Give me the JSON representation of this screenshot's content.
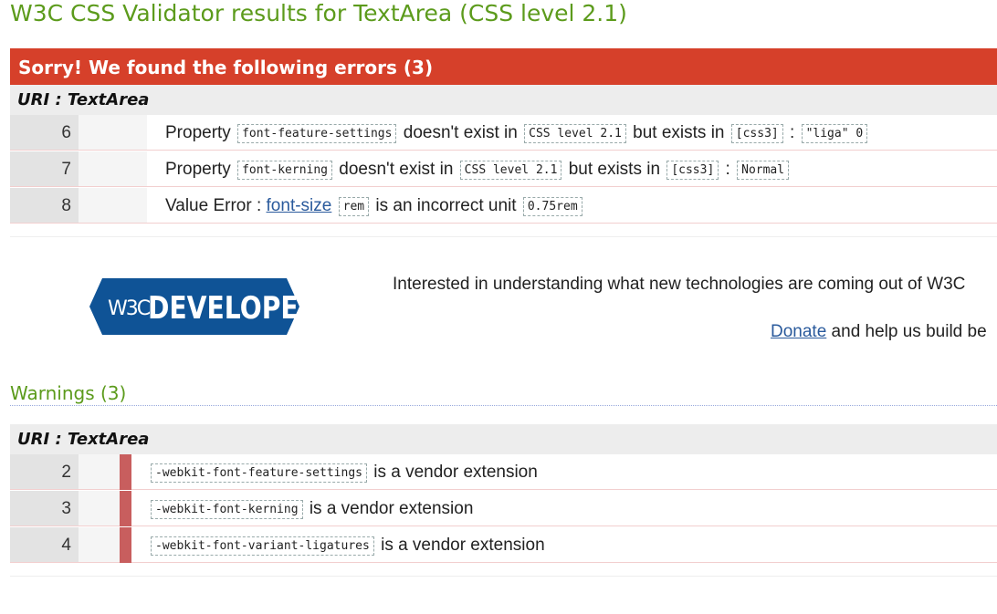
{
  "page": {
    "title": "W3C CSS Validator results for TextArea (CSS level 2.1)"
  },
  "errors": {
    "banner": "Sorry! We found the following errors (3)",
    "uri_label": "URI : TextArea",
    "rows": [
      {
        "line": "6",
        "parts": [
          {
            "t": "text",
            "v": "Property "
          },
          {
            "t": "code",
            "v": "font-feature-settings"
          },
          {
            "t": "text",
            "v": " doesn't exist in "
          },
          {
            "t": "code",
            "v": "CSS level 2.1"
          },
          {
            "t": "text",
            "v": " but exists in "
          },
          {
            "t": "code",
            "v": "[css3]"
          },
          {
            "t": "text",
            "v": " : "
          },
          {
            "t": "code",
            "v": "\"liga\" 0"
          }
        ]
      },
      {
        "line": "7",
        "parts": [
          {
            "t": "text",
            "v": "Property "
          },
          {
            "t": "code",
            "v": "font-kerning"
          },
          {
            "t": "text",
            "v": " doesn't exist in "
          },
          {
            "t": "code",
            "v": "CSS level 2.1"
          },
          {
            "t": "text",
            "v": " but exists in "
          },
          {
            "t": "code",
            "v": "[css3]"
          },
          {
            "t": "text",
            "v": " : "
          },
          {
            "t": "code",
            "v": "Normal"
          }
        ]
      },
      {
        "line": "8",
        "parts": [
          {
            "t": "text",
            "v": "Value Error : "
          },
          {
            "t": "link",
            "v": "font-size"
          },
          {
            "t": "text",
            "v": " "
          },
          {
            "t": "code",
            "v": "rem"
          },
          {
            "t": "text",
            "v": " is an incorrect unit "
          },
          {
            "t": "code",
            "v": "0.75rem"
          }
        ]
      }
    ]
  },
  "promo": {
    "logo_mark": "W3C",
    "logo_text": "DEVELOPERS",
    "logo_color": "#0f5396",
    "text": "Interested in understanding what new technologies are coming out of W3C",
    "donate_link": "Donate",
    "donate_rest": " and help us build be"
  },
  "warnings": {
    "heading": "Warnings (3)",
    "uri_label": "URI : TextArea",
    "rows": [
      {
        "line": "2",
        "parts": [
          {
            "t": "code",
            "v": "-webkit-font-feature-settings"
          },
          {
            "t": "text",
            "v": " is a vendor extension"
          }
        ]
      },
      {
        "line": "3",
        "parts": [
          {
            "t": "code",
            "v": "-webkit-font-kerning"
          },
          {
            "t": "text",
            "v": " is a vendor extension"
          }
        ]
      },
      {
        "line": "4",
        "parts": [
          {
            "t": "code",
            "v": "-webkit-font-variant-ligatures"
          },
          {
            "t": "text",
            "v": " is a vendor extension"
          }
        ]
      }
    ]
  },
  "colors": {
    "title_green": "#5c9b1c",
    "error_red": "#d6402a",
    "warning_marker": "#c85e5e",
    "link_blue": "#2a5a9c"
  }
}
